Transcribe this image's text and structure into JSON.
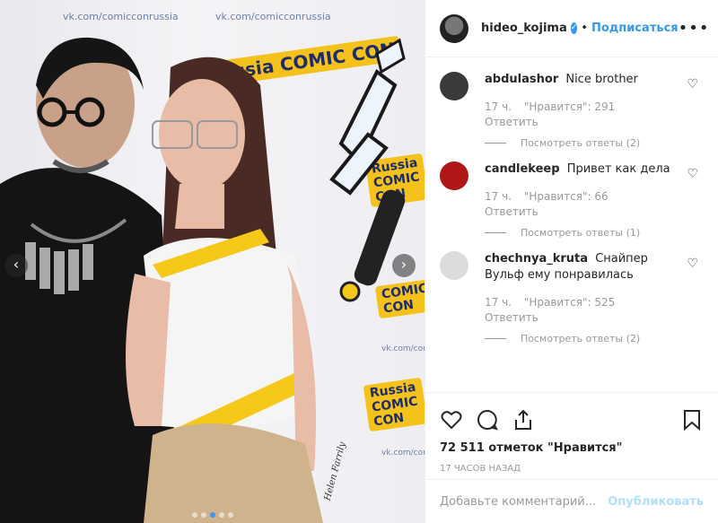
{
  "photo": {
    "backdrop_urls": [
      "vk.com/comicconrussia",
      "vk.com/comicconrussia",
      "vk.com/comicconrussia",
      "vk.com/comicconrussia"
    ],
    "backdrop_logos": [
      "Russia COMIC CON",
      "Russia COMIC CON",
      "COMIC CON",
      "Russia COMIC CON"
    ],
    "tattoo_text": "Helen Farrily",
    "prev_arrow": "‹",
    "next_arrow": "›",
    "dots_count": 5,
    "active_dot": 3
  },
  "header": {
    "username": "hideo_kojima",
    "verified_icon": "verified-check-icon",
    "separator": "•",
    "follow_label": "Подписаться",
    "more_label": "•••"
  },
  "comments": [
    {
      "user": "abdulashor",
      "text": "Nice brother",
      "time": "17 ч.",
      "likes": "\"Нравится\": 291",
      "reply_label": "Ответить",
      "view_replies": "Посмотреть ответы (2)",
      "avatar_color": "#3a3a3a"
    },
    {
      "user": "candlekeep",
      "text": "Привет как дела",
      "time": "17 ч.",
      "likes": "\"Нравится\": 66",
      "reply_label": "Ответить",
      "view_replies": "Посмотреть ответы (1)",
      "avatar_color": "#b01818"
    },
    {
      "user": "chechnya_kruta",
      "text": "Снайпер Вульф ему понравилась",
      "time": "17 ч.",
      "likes": "\"Нравится\": 525",
      "reply_label": "Ответить",
      "view_replies": "Посмотреть ответы (2)",
      "avatar_color": "#dcdcdc"
    }
  ],
  "actions": {
    "like_icon": "heart-icon",
    "comment_icon": "comment-icon",
    "share_icon": "share-icon",
    "save_icon": "bookmark-icon",
    "likes_text": "72 511 отметок \"Нравится\"",
    "time_ago": "17 часов назад"
  },
  "comment_box": {
    "placeholder": "Добавьте комментарий...",
    "publish_label": "Опубликовать"
  },
  "colors": {
    "accent": "#3897f0",
    "publish_disabled": "#b2dffc",
    "muted": "#999999"
  }
}
